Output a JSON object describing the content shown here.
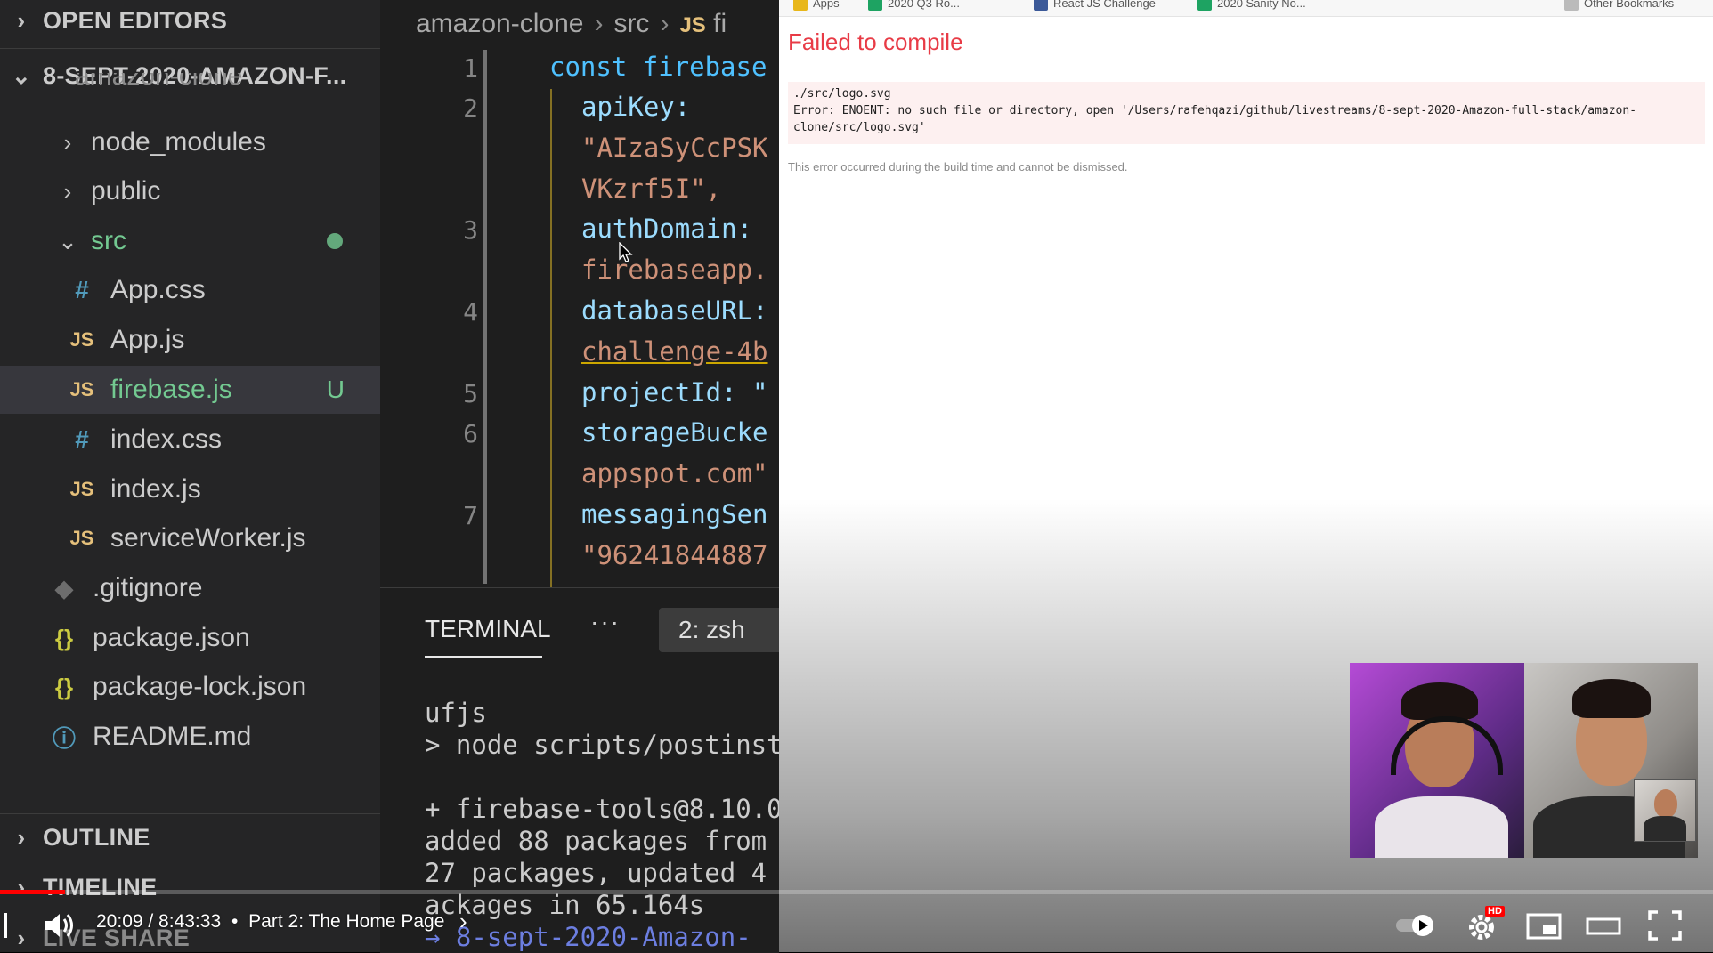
{
  "sidebar": {
    "open_editors": "OPEN EDITORS",
    "workspace": "8-SEPT-2020-AMAZON-F...",
    "partial_folder": "amazon-clone",
    "items": [
      {
        "label": "node_modules",
        "icon": "chevron-right-icon"
      },
      {
        "label": "public",
        "icon": "chevron-right-icon"
      },
      {
        "label": "src",
        "icon": "chevron-down-icon"
      },
      {
        "label": "App.css",
        "icon": "css-file-icon",
        "icon_text": "#"
      },
      {
        "label": "App.js",
        "icon": "js-file-icon",
        "icon_text": "JS"
      },
      {
        "label": "firebase.js",
        "icon": "js-file-icon",
        "icon_text": "JS",
        "badge": "U"
      },
      {
        "label": "index.css",
        "icon": "css-file-icon",
        "icon_text": "#"
      },
      {
        "label": "index.js",
        "icon": "js-file-icon",
        "icon_text": "JS"
      },
      {
        "label": "serviceWorker.js",
        "icon": "js-file-icon",
        "icon_text": "JS"
      },
      {
        "label": ".gitignore",
        "icon": "git-file-icon",
        "icon_text": "◆"
      },
      {
        "label": "package.json",
        "icon": "json-file-icon",
        "icon_text": "{}"
      },
      {
        "label": "package-lock.json",
        "icon": "json-file-icon",
        "icon_text": "{}"
      },
      {
        "label": "README.md",
        "icon": "info-file-icon",
        "icon_text": "ⓘ"
      }
    ],
    "outline": "OUTLINE",
    "timeline": "TIMELINE",
    "live_share": "LIVE SHARE"
  },
  "editor": {
    "breadcrumb": [
      "amazon-clone",
      "src",
      "JS",
      "fi"
    ],
    "line_numbers": [
      "1",
      "2",
      "3",
      "4",
      "5",
      "6",
      "7"
    ],
    "lines": [
      "const firebase",
      "apiKey:",
      "\"AIzaSyCcPSK",
      "VKzrf5I\",",
      "authDomain:",
      "firebaseapp.",
      "databaseURL:",
      "challenge-4b",
      "projectId: \"",
      "storageBucke",
      "appspot.com\"",
      "messagingSen",
      "\"96241844887"
    ]
  },
  "terminal": {
    "tab": "TERMINAL",
    "more": "···",
    "shell": "2: zsh",
    "lines": [
      "ufjs",
      "> node scripts/postinst",
      "",
      "+ firebase-tools@8.10.0",
      "added 88 packages from",
      " 27 packages, updated 4",
      "ackages in 65.164s",
      "→ 8-sept-2020-Amazon-"
    ]
  },
  "browser": {
    "bookmarks": [
      "Apps",
      "2020 Q3 Ro...",
      "React JS Challenge",
      "2020 Sanity No...",
      "Other Bookmarks"
    ],
    "title": "Failed to compile",
    "error_lines": [
      "./src/logo.svg",
      "Error: ENOENT: no such file or directory, open '/Users/rafehqazi/github/livestreams/8-sept-2020-Amazon-full-stack/amazon-",
      "clone/src/logo.svg'"
    ],
    "note": "This error occurred during the build time and cannot be dismissed."
  },
  "player": {
    "time": "20:09 / 8:43:33",
    "bullet": "•",
    "chapter": "Part 2: The Home Page",
    "progress_fraction": 0.038,
    "hd_badge": "HD"
  },
  "colors": {
    "sidebar_bg": "#252526",
    "editor_bg": "#1e1e1e",
    "error_red": "#e83b46",
    "untracked_green": "#73c991",
    "progress_red": "#ff0000"
  }
}
